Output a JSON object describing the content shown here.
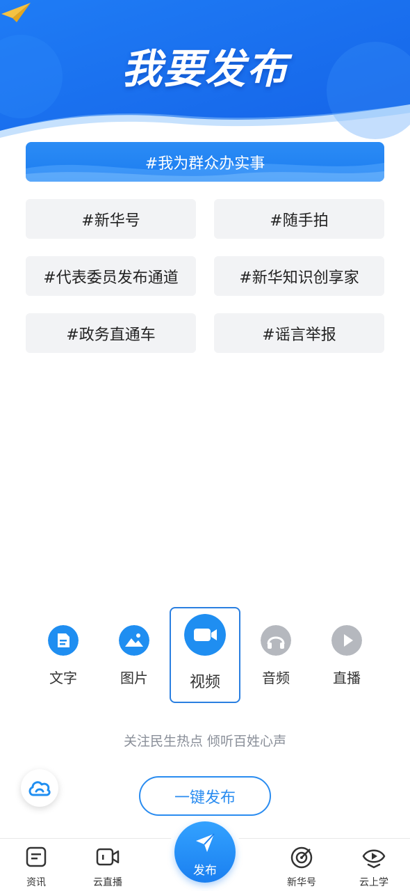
{
  "header": {
    "title": "我要发布"
  },
  "featured_topic": {
    "label": "#我为群众办实事"
  },
  "topics": [
    {
      "label": "#新华号"
    },
    {
      "label": "#随手拍"
    },
    {
      "label": "#代表委员发布通道"
    },
    {
      "label": "#新华知识创享家"
    },
    {
      "label": "#政务直通车"
    },
    {
      "label": "#谣言举报"
    }
  ],
  "publish_types": [
    {
      "label": "文字",
      "icon": "document-icon",
      "color": "#1f8ef1",
      "active": false
    },
    {
      "label": "图片",
      "icon": "image-icon",
      "color": "#1f8ef1",
      "active": false
    },
    {
      "label": "视频",
      "icon": "video-camera-icon",
      "color": "#1f8ef1",
      "active": true
    },
    {
      "label": "音频",
      "icon": "headphones-icon",
      "color": "#b5b8be",
      "active": false
    },
    {
      "label": "直播",
      "icon": "play-icon",
      "color": "#b5b8be",
      "active": false
    }
  ],
  "slogan": "关注民生热点 倾听百姓心声",
  "one_key_publish": {
    "label": "一键发布"
  },
  "tabbar": {
    "items": [
      {
        "label": "资讯",
        "icon": "news-icon"
      },
      {
        "label": "云直播",
        "icon": "video-live-icon"
      },
      {
        "label": "发布",
        "icon": "paper-plane-icon"
      },
      {
        "label": "新华号",
        "icon": "target-icon"
      },
      {
        "label": "云上学",
        "icon": "eye-play-icon"
      }
    ]
  },
  "colors": {
    "accent": "#1f8ef1",
    "inactive": "#b5b8be",
    "banner": "#1b6ff0"
  }
}
